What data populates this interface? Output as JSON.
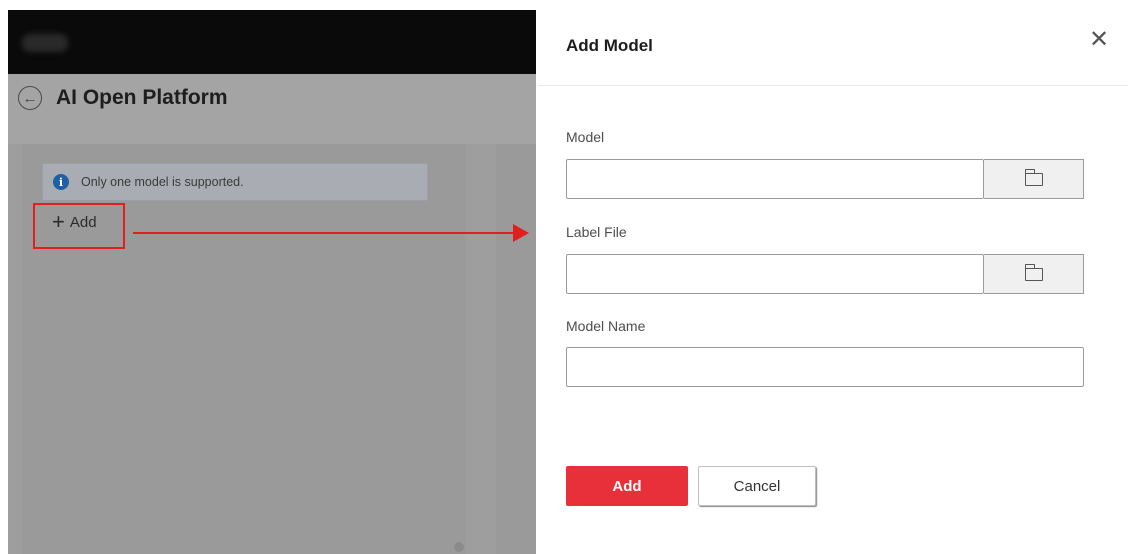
{
  "background_app": {
    "title": "AI Open Platform",
    "notice_text": "Only one model is supported.",
    "add_label": "Add",
    "back_icon": "arrow-left-circle-icon",
    "info_icon": "info-icon",
    "info_icon_glyph": "i",
    "back_glyph": "←",
    "plus_glyph": "+"
  },
  "annotation": {
    "highlight_color": "#e0201f"
  },
  "dialog": {
    "title": "Add Model",
    "close_glyph": "✕",
    "fields": {
      "model_label": "Model",
      "model_value": "",
      "label_file_label": "Label File",
      "label_file_value": "",
      "model_name_label": "Model Name",
      "model_name_value": ""
    },
    "buttons": {
      "primary": "Add",
      "secondary": "Cancel"
    },
    "accent_color": "#e8303a"
  }
}
